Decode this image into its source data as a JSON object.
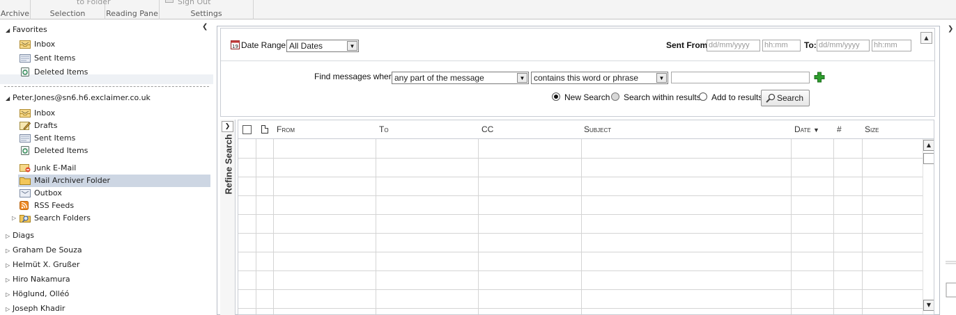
{
  "ribbon": {
    "groups": [
      {
        "label": "Archive"
      },
      {
        "label": "Selection",
        "top_text": "to Folder"
      },
      {
        "label": "Reading Pane"
      },
      {
        "label": "Settings",
        "top_text": "Sign Out"
      }
    ]
  },
  "nav": {
    "favorites": {
      "header": "Favorites",
      "items": [
        {
          "label": "Inbox",
          "icon": "inbox-icon"
        },
        {
          "label": "Sent Items",
          "icon": "sent-items-icon"
        },
        {
          "label": "Deleted Items",
          "icon": "deleted-items-icon"
        }
      ]
    },
    "mailbox": {
      "header": "Peter.Jones@sn6.h6.exclaimer.co.uk",
      "items": [
        {
          "label": "Inbox",
          "icon": "inbox-icon"
        },
        {
          "label": "Drafts",
          "icon": "drafts-icon"
        },
        {
          "label": "Sent Items",
          "icon": "sent-items-icon"
        },
        {
          "label": "Deleted Items",
          "icon": "deleted-items-icon"
        },
        {
          "label": "Junk E-Mail",
          "icon": "junk-email-icon"
        },
        {
          "label": "Mail Archiver Folder",
          "icon": "folder-icon",
          "selected": true
        },
        {
          "label": "Outbox",
          "icon": "outbox-icon"
        },
        {
          "label": "RSS Feeds",
          "icon": "rss-icon"
        },
        {
          "label": "Search Folders",
          "icon": "search-folder-icon",
          "expandable": true
        }
      ]
    },
    "other_mailboxes": [
      "Diags",
      "Graham De Souza",
      "Helmüt X. Grußer",
      "Hiro Nakamura",
      "Höglund, Olléó",
      "Joseph Khadir"
    ]
  },
  "search": {
    "date_range_label": "Date Range:",
    "date_range_value": "All Dates",
    "sent_from_label": "Sent From:",
    "date_placeholder": "dd/mm/yyyy",
    "time_placeholder": "hh:mm",
    "to_label": "To:",
    "find_label": "Find messages where",
    "field_value": "any part of the message",
    "condition_value": "contains this word or phrase",
    "term_value": "",
    "options": [
      {
        "label": "New Search",
        "selected": true
      },
      {
        "label": "Search within results",
        "selected": false
      },
      {
        "label": "Add to results",
        "selected": false
      }
    ],
    "search_button": "Search"
  },
  "refine": {
    "label": "Refine Search"
  },
  "grid": {
    "columns": [
      "From",
      "To",
      "CC",
      "Subject",
      "Date",
      "#",
      "Size"
    ],
    "sort_column": "Date",
    "sort_direction": "desc",
    "rows": []
  },
  "colors": {
    "selected_row": "#cdd6e3",
    "panel_border": "#c8ccd3",
    "plus_green": "#2e9d2e",
    "folder_yellow": "#f2c65a"
  }
}
